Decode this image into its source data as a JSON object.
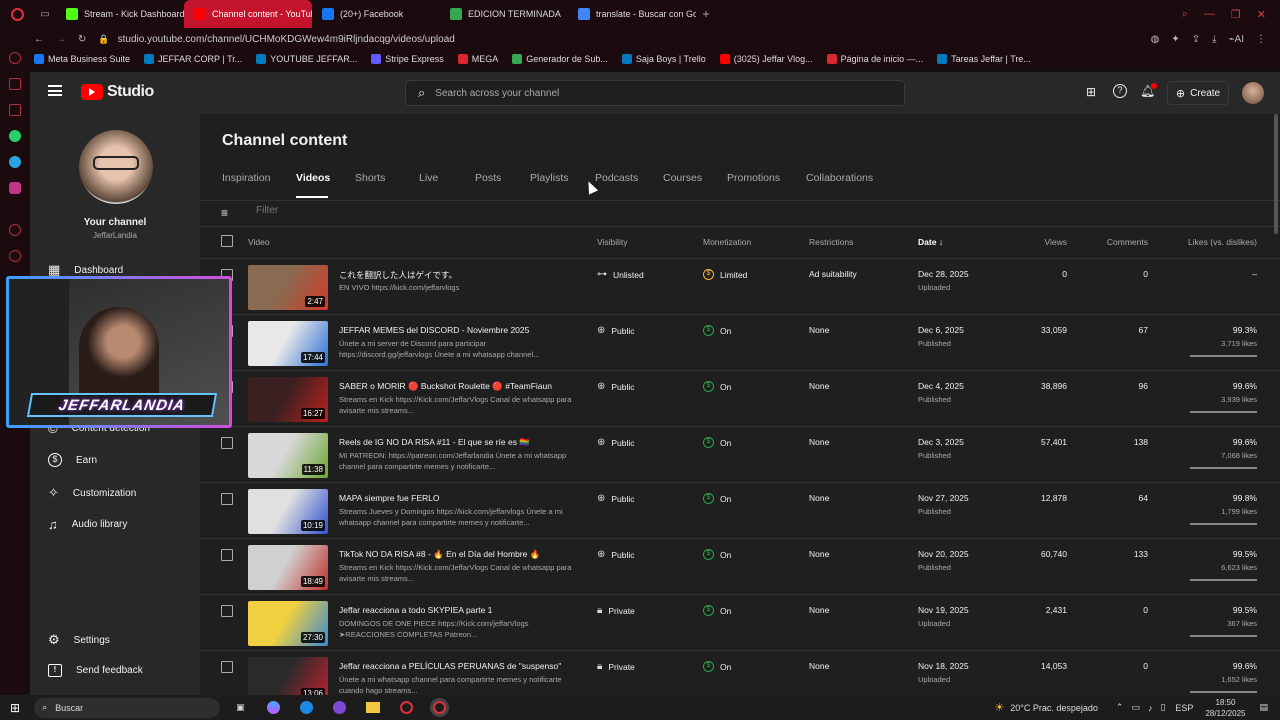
{
  "browser": {
    "tabs": [
      {
        "label": "Stream - Kick Dashboard",
        "color": "#53fc18"
      },
      {
        "label": "Channel content - YouTube",
        "color": "#ff0000"
      },
      {
        "label": "(20+) Facebook",
        "color": "#1877f2"
      },
      {
        "label": "EDICION TERMINADA",
        "color": "#34a853"
      },
      {
        "label": "translate - Buscar con Goo",
        "color": "#4285f4"
      }
    ],
    "url": "studio.youtube.com/channel/UCHMoKDGWew4m9iRljndacqg/videos/upload",
    "bookmarks": [
      {
        "label": "Meta Business Suite",
        "color": "#1877f2"
      },
      {
        "label": "JEFFAR CORP | Tr...",
        "color": "#0079bf"
      },
      {
        "label": "YOUTUBE JEFFAR...",
        "color": "#0079bf"
      },
      {
        "label": "Stripe Express",
        "color": "#635bff"
      },
      {
        "label": "MEGA",
        "color": "#d9272e"
      },
      {
        "label": "Generador de Sub...",
        "color": "#34a853"
      },
      {
        "label": "Saja Boys | Trello",
        "color": "#0079bf"
      },
      {
        "label": "(3025) Jeffar Vlog...",
        "color": "#ff0000"
      },
      {
        "label": "Página de inicio —...",
        "color": "#d9272e"
      },
      {
        "label": "Tareas Jeffar | Tre...",
        "color": "#0079bf"
      }
    ]
  },
  "header": {
    "logo": "Studio",
    "search_placeholder": "Search across your channel",
    "create_label": "Create"
  },
  "sidebar": {
    "your_channel": "Your channel",
    "channel_name": "JeffarLandia",
    "items": [
      {
        "label": "Dashboard",
        "icon": "dashboard-icon"
      },
      {
        "label": "Content detection",
        "icon": "copyright-icon"
      },
      {
        "label": "Earn",
        "icon": "dollar-icon"
      },
      {
        "label": "Customization",
        "icon": "wand-icon"
      },
      {
        "label": "Audio library",
        "icon": "music-icon"
      }
    ],
    "settings": "Settings",
    "feedback": "Send feedback",
    "overlay_text": "JEFFARLANDIA"
  },
  "page": {
    "title": "Channel content",
    "tabs": [
      "Inspiration",
      "Videos",
      "Shorts",
      "Live",
      "Posts",
      "Playlists",
      "Podcasts",
      "Courses",
      "Promotions",
      "Collaborations"
    ],
    "filter_placeholder": "Filter",
    "columns": {
      "video": "Video",
      "visibility": "Visibility",
      "monetization": "Monetization",
      "restrictions": "Restrictions",
      "date": "Date",
      "views": "Views",
      "comments": "Comments",
      "likes": "Likes (vs. dislikes)"
    }
  },
  "videos": [
    {
      "title": "これを翻訳した人はゲイです。",
      "desc": "EN VIVO https://kick.com/jeffarvlogs",
      "duration": "2:47",
      "visibility": "Unlisted",
      "vis_icon": "link-icon",
      "monetization": "Limited",
      "mon_color": "#f2b33d",
      "restrictions": "Ad suitability",
      "date": "Dec 28, 2025",
      "status": "Uploaded",
      "views": "0",
      "comments": "0",
      "likes_pct": "–",
      "likes": "",
      "thumb": [
        "#8a6a50",
        "#d23a2a"
      ]
    },
    {
      "title": "JEFFAR MEMES del DISCORD - Noviembre 2025",
      "desc": "Únete a mi server de Discord para participar https://discord.gg/jeffarvlogs Únete a mi whatsapp channel...",
      "duration": "17:44",
      "visibility": "Public",
      "vis_icon": "globe-icon",
      "monetization": "On",
      "mon_color": "#2ba640",
      "restrictions": "None",
      "date": "Dec 6, 2025",
      "status": "Published",
      "views": "33,059",
      "comments": "67",
      "likes_pct": "99.3%",
      "likes": "3,719 likes",
      "thumb": [
        "#e8e8e8",
        "#2a6fd6"
      ]
    },
    {
      "title": "SABER o MORIR 🔴 Buckshot Roulette 🔴 #TeamFiaun",
      "desc": "Streams en Kick https://Kick.com/JeffarVlogs Canal de whatsapp para avisarte mis streams...",
      "duration": "16:27",
      "visibility": "Public",
      "vis_icon": "globe-icon",
      "monetization": "On",
      "mon_color": "#2ba640",
      "restrictions": "None",
      "date": "Dec 4, 2025",
      "status": "Published",
      "views": "38,896",
      "comments": "96",
      "likes_pct": "99.6%",
      "likes": "3,939 likes",
      "thumb": [
        "#3a2020",
        "#c02020"
      ]
    },
    {
      "title": "Reels de IG NO DA RISA #11 - El que se ríe es 🏳️‍🌈",
      "desc": "MI PATREON: https://patreon.com/Jeffarlandia Únete a mi whatsapp channel para compartirte memes y notificarte...",
      "duration": "11:38",
      "visibility": "Public",
      "vis_icon": "globe-icon",
      "monetization": "On",
      "mon_color": "#2ba640",
      "restrictions": "None",
      "date": "Dec 3, 2025",
      "status": "Published",
      "views": "57,401",
      "comments": "138",
      "likes_pct": "99.6%",
      "likes": "7,068 likes",
      "thumb": [
        "#d8d8d8",
        "#6aa530"
      ]
    },
    {
      "title": "MAPA siempre fue FERLO",
      "desc": "Streams Jueves y Domingos https://kick.com/jeffarvlogs Únete a mi whatsapp channel para compartirte memes y notificarte...",
      "duration": "10:19",
      "visibility": "Public",
      "vis_icon": "globe-icon",
      "monetization": "On",
      "mon_color": "#2ba640",
      "restrictions": "None",
      "date": "Nov 27, 2025",
      "status": "Published",
      "views": "12,878",
      "comments": "64",
      "likes_pct": "99.8%",
      "likes": "1,799 likes",
      "thumb": [
        "#e0e0e0",
        "#3050d0"
      ]
    },
    {
      "title": "TikTok NO DA RISA #8 - 🔥 En el Día del Hombre 🔥",
      "desc": "Streams en Kick https://Kick.com/JeffarVlogs Canal de whatsapp para avisarte mis streams...",
      "duration": "18:49",
      "visibility": "Public",
      "vis_icon": "globe-icon",
      "monetization": "On",
      "mon_color": "#2ba640",
      "restrictions": "None",
      "date": "Nov 20, 2025",
      "status": "Published",
      "views": "60,740",
      "comments": "133",
      "likes_pct": "99.5%",
      "likes": "6,623 likes",
      "thumb": [
        "#d0d0d0",
        "#c0302a"
      ]
    },
    {
      "title": "Jeffar reacciona a todo SKYPIEA parte 1",
      "desc": "DOMINGOS DE ONE PIECE https://Kick.com/jeffarVlogs ➤REACCIONES COMPLETAS Patreon...",
      "duration": "27:30",
      "visibility": "Private",
      "vis_icon": "lock-icon",
      "monetization": "On",
      "mon_color": "#2ba640",
      "restrictions": "None",
      "date": "Nov 19, 2025",
      "status": "Uploaded",
      "views": "2,431",
      "comments": "0",
      "likes_pct": "99.5%",
      "likes": "367 likes",
      "thumb": [
        "#f0d040",
        "#3a8ad0"
      ]
    },
    {
      "title": "Jeffar reacciona a PELÍCULAS PERUANAS de \"suspenso\"",
      "desc": "Únete a mi whatsapp channel para compartirte memes y notificarte cuando hago streams...",
      "duration": "13:06",
      "visibility": "Private",
      "vis_icon": "lock-icon",
      "monetization": "On",
      "mon_color": "#2ba640",
      "restrictions": "None",
      "date": "Nov 18, 2025",
      "status": "Uploaded",
      "views": "14,053",
      "comments": "0",
      "likes_pct": "99.6%",
      "likes": "1,652 likes",
      "thumb": [
        "#2a2a2a",
        "#c02030"
      ]
    }
  ],
  "taskbar": {
    "search": "Buscar",
    "weather": "20°C  Prac. despejado",
    "lang": "ESP",
    "time": "18:50",
    "date": "28/12/2025"
  }
}
